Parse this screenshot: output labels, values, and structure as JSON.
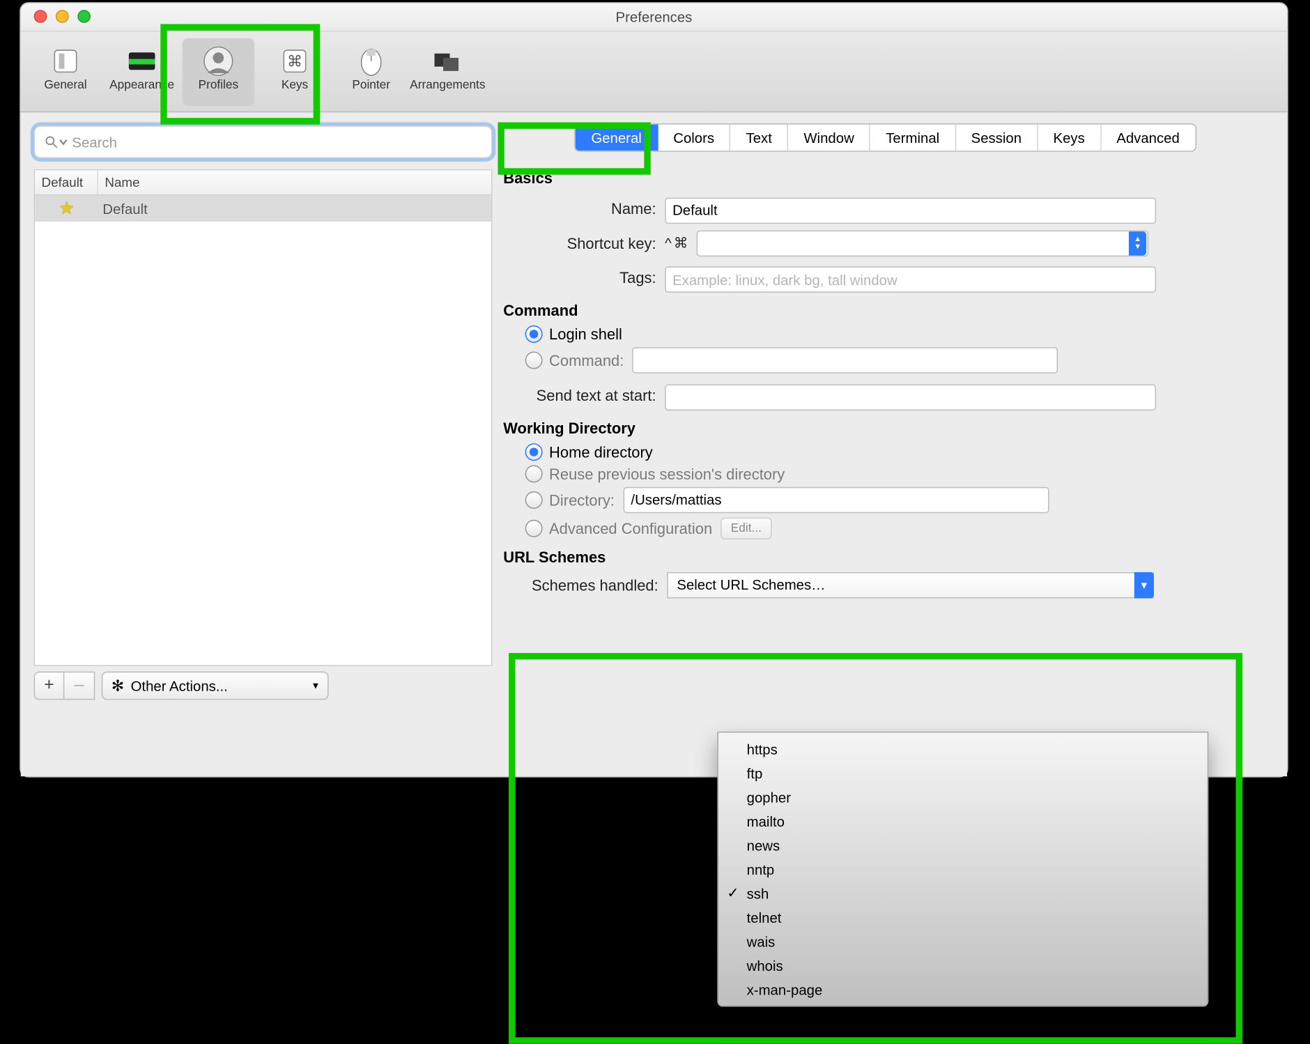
{
  "window": {
    "title": "Preferences"
  },
  "toolbar": {
    "items": [
      {
        "label": "General"
      },
      {
        "label": "Appearance"
      },
      {
        "label": "Profiles"
      },
      {
        "label": "Keys"
      },
      {
        "label": "Pointer"
      },
      {
        "label": "Arrangements"
      }
    ],
    "selectedIndex": 2
  },
  "sidebar": {
    "searchPlaceholder": "Search",
    "columns": {
      "c1": "Default",
      "c2": "Name"
    },
    "rows": [
      {
        "default": true,
        "name": "Default"
      }
    ],
    "footer": {
      "plus": "+",
      "minus": "–",
      "other": "Other Actions..."
    }
  },
  "tabs": {
    "items": [
      "General",
      "Colors",
      "Text",
      "Window",
      "Terminal",
      "Session",
      "Keys",
      "Advanced"
    ],
    "activeIndex": 0
  },
  "sections": {
    "basics": {
      "title": "Basics",
      "nameLabel": "Name:",
      "nameValue": "Default",
      "shortcutLabel": "Shortcut key:",
      "shortcutPrefix": "^⌘",
      "tagsLabel": "Tags:",
      "tagsPlaceholder": "Example: linux, dark bg, tall window"
    },
    "command": {
      "title": "Command",
      "loginShell": "Login shell",
      "commandLabel": "Command:",
      "sendTextLabel": "Send text at start:"
    },
    "workingDir": {
      "title": "Working Directory",
      "home": "Home directory",
      "reuse": "Reuse previous session's directory",
      "directoryLabel": "Directory:",
      "directoryValue": "/Users/mattias",
      "advanced": "Advanced Configuration",
      "editBtn": "Edit..."
    },
    "urlSchemes": {
      "title": "URL Schemes",
      "label": "Schemes handled:",
      "selectPlaceholder": "Select URL Schemes…",
      "options": [
        {
          "label": "https",
          "checked": false
        },
        {
          "label": "ftp",
          "checked": false
        },
        {
          "label": "gopher",
          "checked": false
        },
        {
          "label": "mailto",
          "checked": false
        },
        {
          "label": "news",
          "checked": false
        },
        {
          "label": "nntp",
          "checked": false
        },
        {
          "label": "ssh",
          "checked": true
        },
        {
          "label": "telnet",
          "checked": false
        },
        {
          "label": "wais",
          "checked": false
        },
        {
          "label": "whois",
          "checked": false
        },
        {
          "label": "x-man-page",
          "checked": false
        }
      ]
    }
  }
}
